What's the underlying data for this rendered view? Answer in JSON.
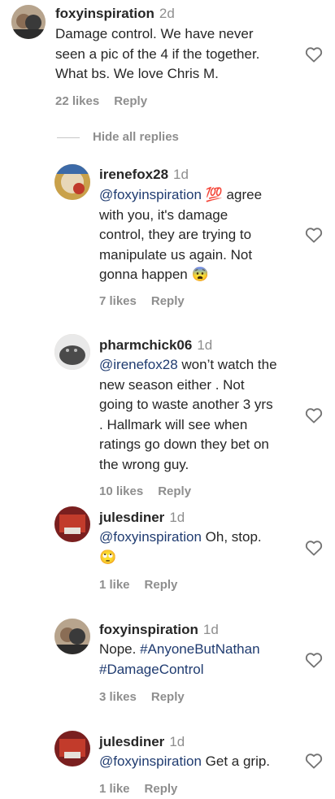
{
  "comments": [
    {
      "user": "foxyinspiration",
      "time": "2d",
      "lines": [
        [
          {
            "t": "Damage control. We have never"
          }
        ],
        [
          {
            "t": "seen a pic of the 4 if the together."
          }
        ],
        [
          {
            "t": "What bs. We love Chris M."
          }
        ]
      ],
      "likes": "22 likes",
      "reply": "Reply"
    },
    {
      "user": "irenefox28",
      "time": "1d",
      "lines": [
        [
          {
            "t": "@foxyinspiration",
            "m": true
          },
          {
            "t": " 💯 agree"
          }
        ],
        [
          {
            "t": "with you, it's damage"
          }
        ],
        [
          {
            "t": "control, they are trying to"
          }
        ],
        [
          {
            "t": "manipulate us again. Not"
          }
        ],
        [
          {
            "t": "gonna happen 😨"
          }
        ]
      ],
      "likes": "7 likes",
      "reply": "Reply"
    },
    {
      "user": "pharmchick06",
      "time": "1d",
      "lines": [
        [
          {
            "t": "@irenefox28",
            "m": true
          },
          {
            "t": " won’t watch the"
          }
        ],
        [
          {
            "t": "new season either . Not"
          }
        ],
        [
          {
            "t": "going to waste another 3 yrs"
          }
        ],
        [
          {
            "t": ". Hallmark will see when"
          }
        ],
        [
          {
            "t": "ratings go down they bet on"
          }
        ],
        [
          {
            "t": "the wrong guy."
          }
        ]
      ],
      "likes": "10 likes",
      "reply": "Reply"
    },
    {
      "user": "julesdiner",
      "time": "1d",
      "lines": [
        [
          {
            "t": "@foxyinspiration",
            "m": true
          },
          {
            "t": " Oh, stop."
          }
        ],
        [
          {
            "t": "🙄"
          }
        ]
      ],
      "likes": "1 like",
      "reply": "Reply"
    },
    {
      "user": "foxyinspiration",
      "time": "1d",
      "lines": [
        [
          {
            "t": "Nope. "
          },
          {
            "t": "#AnyoneButNathan",
            "m": true
          }
        ],
        [
          {
            "t": "#DamageControl",
            "m": true
          }
        ]
      ],
      "likes": "3 likes",
      "reply": "Reply"
    },
    {
      "user": "julesdiner",
      "time": "1d",
      "lines": [
        [
          {
            "t": "@foxyinspiration",
            "m": true
          },
          {
            "t": " Get a grip."
          }
        ]
      ],
      "likes": "1 like",
      "reply": "Reply"
    }
  ],
  "hide_replies_label": "Hide all replies",
  "icons": {
    "like": "heart-outline-icon"
  }
}
